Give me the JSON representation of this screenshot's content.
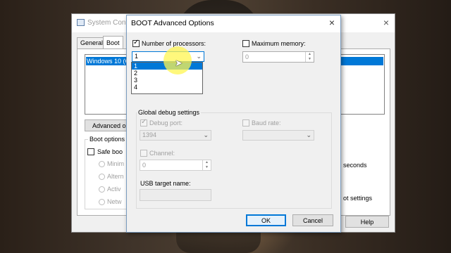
{
  "background_window": {
    "title": "System Conf",
    "close_glyph": "×",
    "tabs": [
      "General",
      "Boot"
    ],
    "active_tab": "Boot",
    "os_entry": "Windows 10 (C",
    "advanced_button": "Advanced op",
    "boot_options_label": "Boot options",
    "safe_boot_label": "Safe boo",
    "safe_boot_modes": [
      "Minim",
      "Altern",
      "Activ",
      "Netw"
    ],
    "timeout_fragment": "seconds",
    "settings_fragment": "ot settings",
    "cancel_fragment": "",
    "help_button": "Help"
  },
  "dialog": {
    "title": "BOOT Advanced Options",
    "close_glyph": "×",
    "number_of_processors": {
      "label": "Number of processors:",
      "checked": true,
      "selected": "1",
      "options": [
        "1",
        "2",
        "3",
        "4"
      ],
      "highlighted_option": "1"
    },
    "maximum_memory": {
      "label": "Maximum memory:",
      "checked": false,
      "value": "0"
    },
    "global_debug": {
      "group_label": "Global debug settings",
      "debug_port_label": "Debug port:",
      "debug_port_value": "1394",
      "baud_rate_label": "Baud rate:",
      "baud_rate_value": "",
      "channel_label": "Channel:",
      "channel_value": "0",
      "usb_target_label": "USB target name:",
      "usb_target_value": ""
    },
    "ok_button": "OK",
    "cancel_button": "Cancel"
  },
  "colors": {
    "selection": "#0078d7",
    "cursor_highlight": "#fff550"
  }
}
